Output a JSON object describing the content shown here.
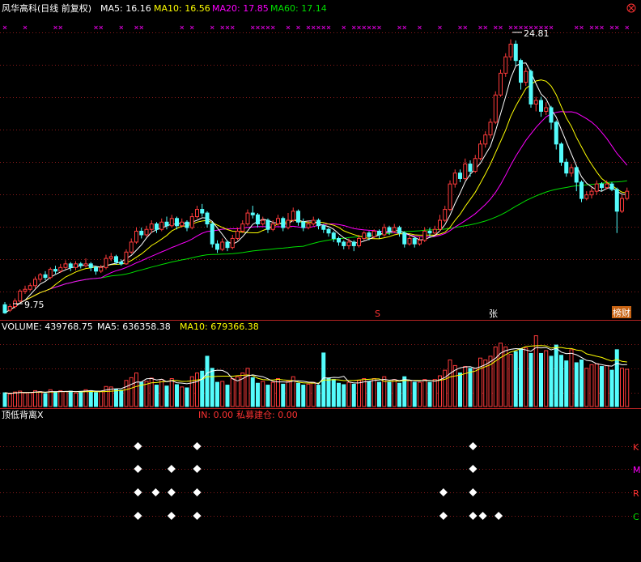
{
  "colors": {
    "background": "#000000",
    "up": "#ff3b3b",
    "down": "#54fcfc",
    "ma5": "#ffffff",
    "ma10": "#ffff00",
    "ma20": "#ff00ff",
    "ma60": "#00e000",
    "grid": "#8b1a1a",
    "label_red": "#ff3232",
    "marker": "#ffffff"
  },
  "price_panel": {
    "stock": "风华高科(日线 前复权)",
    "ma5": "MA5: 16.16",
    "ma10": "MA10: 16.56",
    "ma20": "MA20: 17.85",
    "ma60": "MA60: 17.14",
    "high_label": "24.81",
    "low_label": "9.75",
    "sig_s": "S",
    "sig_zhang": "张",
    "sig_report": "榜财"
  },
  "volume_panel": {
    "label": "VOLUME: 439768.75",
    "ma5": "MA5: 636358.38",
    "ma10": "MA10: 679366.38"
  },
  "indicator_panel": {
    "name": "顶低背离X",
    "in_text": "IN: 0.00",
    "private_text": "私募建仓: 0.00",
    "rows": [
      "K",
      "M",
      "R",
      "C"
    ]
  },
  "chart_data": {
    "type": "candlestick",
    "ylim": [
      9.5,
      26.0
    ],
    "candles": [
      [
        10.2,
        9.75,
        10.35,
        9.7
      ],
      [
        9.9,
        10.1,
        10.25,
        9.8
      ],
      [
        10.1,
        10.4,
        10.55,
        10.0
      ],
      [
        10.4,
        10.95,
        11.05,
        10.35
      ],
      [
        10.95,
        11.05,
        11.25,
        10.8
      ],
      [
        11.05,
        11.25,
        11.4,
        10.95
      ],
      [
        11.25,
        11.6,
        11.75,
        11.1
      ],
      [
        11.6,
        11.85,
        11.95,
        11.45
      ],
      [
        11.85,
        11.7,
        12.05,
        11.55
      ],
      [
        11.7,
        12.15,
        12.25,
        11.6
      ],
      [
        12.15,
        12.05,
        12.35,
        11.9
      ],
      [
        12.05,
        12.25,
        12.45,
        11.95
      ],
      [
        12.25,
        12.45,
        12.65,
        12.15
      ],
      [
        12.45,
        12.25,
        12.55,
        12.05
      ],
      [
        12.25,
        12.45,
        12.6,
        12.1
      ],
      [
        12.45,
        12.35,
        12.55,
        12.2
      ],
      [
        12.35,
        12.45,
        12.75,
        12.25
      ],
      [
        12.45,
        12.25,
        12.55,
        12.05
      ],
      [
        12.25,
        12.05,
        12.35,
        11.85
      ],
      [
        12.05,
        12.25,
        12.4,
        11.95
      ],
      [
        12.25,
        12.75,
        12.95,
        12.15
      ],
      [
        12.75,
        12.85,
        13.05,
        12.6
      ],
      [
        12.85,
        12.55,
        12.95,
        12.4
      ],
      [
        12.55,
        12.45,
        12.7,
        12.35
      ],
      [
        12.45,
        13.1,
        13.25,
        12.4
      ],
      [
        13.1,
        13.65,
        13.85,
        13.0
      ],
      [
        13.65,
        14.25,
        14.45,
        13.55
      ],
      [
        14.25,
        14.05,
        14.45,
        13.85
      ],
      [
        14.05,
        14.35,
        14.55,
        13.95
      ],
      [
        14.35,
        14.65,
        14.85,
        14.15
      ],
      [
        14.65,
        14.35,
        14.75,
        14.15
      ],
      [
        14.35,
        14.75,
        14.95,
        14.25
      ],
      [
        14.75,
        14.55,
        15.05,
        14.35
      ],
      [
        14.55,
        14.95,
        15.15,
        14.45
      ],
      [
        14.95,
        14.55,
        15.05,
        14.35
      ],
      [
        14.55,
        14.75,
        14.95,
        14.45
      ],
      [
        14.75,
        14.45,
        14.85,
        14.25
      ],
      [
        14.45,
        15.05,
        15.25,
        14.35
      ],
      [
        15.05,
        15.45,
        15.65,
        14.95
      ],
      [
        15.45,
        15.25,
        15.75,
        15.05
      ],
      [
        15.25,
        14.65,
        15.35,
        14.45
      ],
      [
        14.65,
        13.55,
        14.75,
        13.35
      ],
      [
        13.55,
        13.25,
        13.75,
        13.05
      ],
      [
        13.25,
        13.65,
        13.85,
        13.15
      ],
      [
        13.65,
        13.35,
        13.75,
        13.15
      ],
      [
        13.35,
        13.85,
        14.05,
        13.25
      ],
      [
        13.85,
        14.25,
        14.45,
        13.75
      ],
      [
        14.25,
        14.65,
        14.85,
        14.15
      ],
      [
        14.65,
        15.25,
        15.45,
        14.55
      ],
      [
        15.25,
        15.15,
        15.65,
        14.95
      ],
      [
        15.15,
        14.65,
        15.25,
        14.45
      ],
      [
        14.65,
        14.85,
        15.05,
        14.55
      ],
      [
        14.85,
        14.35,
        14.95,
        14.15
      ],
      [
        14.35,
        14.65,
        14.85,
        14.25
      ],
      [
        14.65,
        14.95,
        15.15,
        14.55
      ],
      [
        14.95,
        14.45,
        15.05,
        14.25
      ],
      [
        14.45,
        14.85,
        15.25,
        14.35
      ],
      [
        14.85,
        15.35,
        15.55,
        14.75
      ],
      [
        15.35,
        14.75,
        15.45,
        14.55
      ],
      [
        14.75,
        14.45,
        14.95,
        14.25
      ],
      [
        14.45,
        14.65,
        14.85,
        14.35
      ],
      [
        14.65,
        14.85,
        15.05,
        14.55
      ],
      [
        14.85,
        14.55,
        14.95,
        14.35
      ],
      [
        14.55,
        14.35,
        14.65,
        14.15
      ],
      [
        14.35,
        14.15,
        14.45,
        13.95
      ],
      [
        14.15,
        13.85,
        14.25,
        13.65
      ],
      [
        13.85,
        13.65,
        13.95,
        13.45
      ],
      [
        13.65,
        13.45,
        13.75,
        13.25
      ],
      [
        13.45,
        13.65,
        13.85,
        13.25
      ],
      [
        13.65,
        13.45,
        13.75,
        13.15
      ],
      [
        13.45,
        13.85,
        14.05,
        13.35
      ],
      [
        13.85,
        14.15,
        14.25,
        13.75
      ],
      [
        14.15,
        13.95,
        14.25,
        13.75
      ],
      [
        13.95,
        14.25,
        14.35,
        13.85
      ],
      [
        14.25,
        14.05,
        14.35,
        13.85
      ],
      [
        14.05,
        14.45,
        14.65,
        13.95
      ],
      [
        14.45,
        14.25,
        14.55,
        14.05
      ],
      [
        14.25,
        14.45,
        14.65,
        14.15
      ],
      [
        14.45,
        14.15,
        14.55,
        13.95
      ],
      [
        14.15,
        13.55,
        14.25,
        13.35
      ],
      [
        13.55,
        13.85,
        14.05,
        13.45
      ],
      [
        13.85,
        13.55,
        13.95,
        13.35
      ],
      [
        13.55,
        13.75,
        13.95,
        13.45
      ],
      [
        13.75,
        14.25,
        14.45,
        13.65
      ],
      [
        14.25,
        14.15,
        14.45,
        13.95
      ],
      [
        14.15,
        14.35,
        14.55,
        14.05
      ],
      [
        14.35,
        14.85,
        15.15,
        14.25
      ],
      [
        14.85,
        15.45,
        15.65,
        14.75
      ],
      [
        15.45,
        16.85,
        17.05,
        15.35
      ],
      [
        16.85,
        17.45,
        17.65,
        16.65
      ],
      [
        17.45,
        17.15,
        17.65,
        16.95
      ],
      [
        17.15,
        17.95,
        18.25,
        17.05
      ],
      [
        17.95,
        17.55,
        18.15,
        17.25
      ],
      [
        17.55,
        18.25,
        18.45,
        17.45
      ],
      [
        18.25,
        19.05,
        19.25,
        18.15
      ],
      [
        19.05,
        19.55,
        19.75,
        18.85
      ],
      [
        19.55,
        20.25,
        20.45,
        19.35
      ],
      [
        20.25,
        21.75,
        21.95,
        20.15
      ],
      [
        21.75,
        22.95,
        23.15,
        21.65
      ],
      [
        22.95,
        23.85,
        24.05,
        22.75
      ],
      [
        23.85,
        24.55,
        24.81,
        23.65
      ],
      [
        24.55,
        23.65,
        24.75,
        23.35
      ],
      [
        23.65,
        22.45,
        23.75,
        22.05
      ],
      [
        22.45,
        23.05,
        23.25,
        22.25
      ],
      [
        23.05,
        21.25,
        23.15,
        21.05
      ],
      [
        21.25,
        21.45,
        21.65,
        20.85
      ],
      [
        21.45,
        20.85,
        21.65,
        20.55
      ],
      [
        20.85,
        21.05,
        21.35,
        20.65
      ],
      [
        21.05,
        20.25,
        21.15,
        19.85
      ],
      [
        20.25,
        19.05,
        20.35,
        18.75
      ],
      [
        19.05,
        18.05,
        19.15,
        17.85
      ],
      [
        18.05,
        17.45,
        18.25,
        17.25
      ],
      [
        17.45,
        17.75,
        17.95,
        17.25
      ],
      [
        17.75,
        16.95,
        17.85,
        16.45
      ],
      [
        16.95,
        16.05,
        17.05,
        15.85
      ],
      [
        16.05,
        16.25,
        16.45,
        15.95
      ],
      [
        16.25,
        16.45,
        16.65,
        16.05
      ],
      [
        16.45,
        16.85,
        17.05,
        16.25
      ],
      [
        16.85,
        16.65,
        16.95,
        16.45
      ],
      [
        16.65,
        16.85,
        17.05,
        16.55
      ],
      [
        16.85,
        16.55,
        16.95,
        16.45
      ],
      [
        16.55,
        15.35,
        16.65,
        14.15
      ],
      [
        15.35,
        16.05,
        16.25,
        15.25
      ],
      [
        16.05,
        16.45,
        16.65,
        15.95
      ]
    ],
    "volume": {
      "ylim": [
        0,
        1600000
      ],
      "values": [
        295000,
        270000,
        310000,
        330000,
        290000,
        300000,
        340000,
        320000,
        280000,
        360000,
        300000,
        340000,
        320000,
        330000,
        290000,
        310000,
        360000,
        340000,
        300000,
        330000,
        430000,
        420000,
        370000,
        350000,
        560000,
        620000,
        720000,
        520000,
        540000,
        610000,
        460000,
        580000,
        440000,
        600000,
        470000,
        420000,
        400000,
        640000,
        720000,
        760000,
        1080000,
        820000,
        520000,
        540000,
        460000,
        600000,
        640000,
        720000,
        820000,
        620000,
        500000,
        540000,
        460000,
        520000,
        600000,
        480000,
        540000,
        640000,
        500000,
        460000,
        480000,
        520000,
        460000,
        1150000,
        600000,
        580000,
        500000,
        470000,
        520000,
        480000,
        560000,
        600000,
        540000,
        600000,
        520000,
        640000,
        520000,
        580000,
        500000,
        640000,
        560000,
        520000,
        520000,
        580000,
        520000,
        580000,
        660000,
        780000,
        1000000,
        880000,
        720000,
        860000,
        820000,
        820000,
        1040000,
        1000000,
        1080000,
        1280000,
        1360000,
        1280000,
        1120000,
        1180000,
        1240000,
        1260000,
        1140000,
        1520000,
        1140000,
        1200000,
        1080000,
        1320000,
        1100000,
        980000,
        1220000,
        940000,
        1000000,
        820000,
        900000,
        920000,
        860000,
        880000,
        780000,
        1220000,
        820000,
        800000
      ],
      "ma5": [
        295000,
        282500,
        291667,
        301250,
        299000,
        300000,
        312000,
        316000,
        306000,
        320000,
        320000,
        320000,
        324000,
        326000,
        318000,
        326000,
        332000,
        340000,
        330000,
        332000,
        354000,
        374000,
        380000,
        384000,
        426000,
        476000,
        524000,
        528000,
        594000,
        602000,
        570000,
        586000,
        530000,
        554000,
        512000,
        502000,
        488000,
        510000,
        534000,
        590000,
        718000,
        764000,
        780000,
        776000,
        724000,
        594000,
        552000,
        596000,
        660000,
        680000,
        660000,
        640000,
        594000,
        540000,
        528000,
        528000,
        524000,
        548000,
        552000,
        544000,
        524000,
        520000,
        486000,
        616000,
        612000,
        626000,
        622000,
        648000,
        528000,
        506000,
        506000,
        528000,
        540000,
        560000,
        568000,
        582000,
        566000,
        578000,
        556000,
        578000,
        568000,
        552000,
        548000,
        564000,
        560000,
        544000,
        576000,
        624000,
        708000,
        780000,
        832000,
        850000,
        856000,
        820000,
        852000,
        900000,
        964000,
        1036000,
        1144000,
        1200000,
        1228000,
        1244000,
        1236000,
        1216000,
        1188000,
        1268000,
        1260000,
        1268000,
        1216000,
        1252000,
        1168000,
        1136000,
        1144000,
        1112000,
        1052000,
        992000,
        976000,
        916000,
        900000,
        876000,
        868000,
        932000,
        896000,
        900000
      ],
      "ma10": [
        295000,
        282500,
        291667,
        301250,
        299000,
        300000,
        305714,
        307500,
        306667,
        312000,
        312500,
        319500,
        320500,
        320500,
        320500,
        315000,
        319000,
        321000,
        319000,
        316000,
        321000,
        329000,
        337000,
        341000,
        364000,
        395000,
        431000,
        455000,
        480000,
        509000,
        514000,
        530000,
        537000,
        562000,
        559000,
        539000,
        540000,
        552000,
        570000,
        585000,
        644000,
        640000,
        651000,
        653000,
        652000,
        650000,
        662000,
        670000,
        679000,
        665000,
        607000,
        579000,
        573000,
        571000,
        585000,
        573000,
        563000,
        555000,
        523000,
        507000,
        505000,
        503000,
        504000,
        568000,
        568000,
        578000,
        573000,
        556000,
        558000,
        561000,
        569000,
        577000,
        585000,
        593000,
        593000,
        539000,
        541000,
        546000,
        546000,
        558000,
        558000,
        560000,
        558000,
        556000,
        556000,
        550000,
        564000,
        584000,
        634000,
        658000,
        674000,
        708000,
        738000,
        762000,
        814000,
        856000,
        898000,
        978000,
        1048000,
        1114000,
        1170000,
        1202000,
        1244000,
        1288000,
        1298000,
        1306000,
        1310000,
        1302000,
        1254000,
        1270000,
        1268000,
        1248000,
        1246000,
        1214000,
        1200000,
        1130000,
        1106000,
        1078000,
        1054000,
        1010000,
        978000,
        1010000,
        970000,
        956000
      ]
    },
    "ma_lines_note": "MA5/MA10/MA20/MA60 curves are computed from closes"
  },
  "signals": {
    "rows": [
      {
        "label": "K",
        "marks": [
          7,
          10,
          24
        ]
      },
      {
        "label": "M",
        "marks": [
          7,
          8.7,
          10,
          24
        ]
      },
      {
        "label": "R",
        "marks": [
          7,
          7.9,
          8.7,
          10,
          22.5,
          24
        ]
      },
      {
        "label": "C",
        "marks": [
          7,
          8.7,
          10,
          22.5,
          24,
          24.5,
          25.3
        ]
      }
    ]
  }
}
